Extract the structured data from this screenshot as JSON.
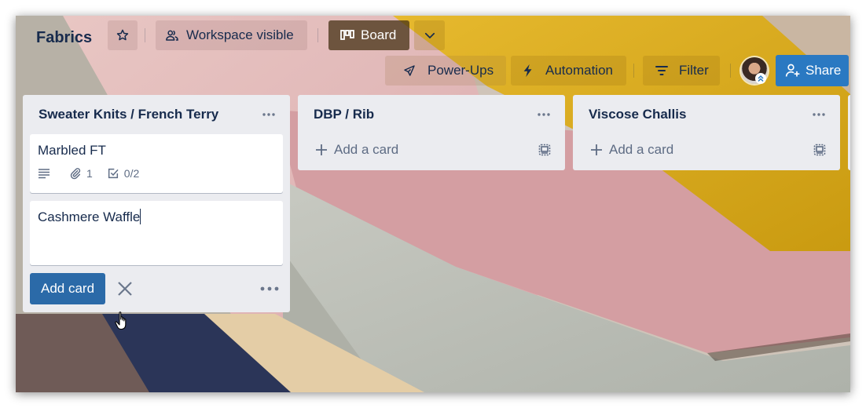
{
  "header": {
    "board_title": "Fabrics",
    "star_icon": "star-icon",
    "visibility_label": "Workspace visible",
    "view_label": "Board",
    "power_ups_label": "Power-Ups",
    "automation_label": "Automation",
    "filter_label": "Filter",
    "share_label": "Share"
  },
  "lists": [
    {
      "title": "Sweater Knits / French Terry",
      "cards": [
        {
          "title": "Marbled FT",
          "badges": {
            "description": true,
            "attachments": "1",
            "checklist": "0/2"
          }
        }
      ],
      "composer": {
        "value": "Cashmere Waffle",
        "add_label": "Add card"
      }
    },
    {
      "title": "DBP / Rib",
      "cards": [],
      "add_card_label": "Add a card"
    },
    {
      "title": "Viscose Challis",
      "cards": [],
      "add_card_label": "Add a card"
    }
  ],
  "colors": {
    "share_button": "#2a79c2",
    "add_card_button": "#2b6aa8",
    "list_background": "#ebecf0",
    "text_primary": "#172b4d",
    "text_secondary": "#5e6c84"
  }
}
